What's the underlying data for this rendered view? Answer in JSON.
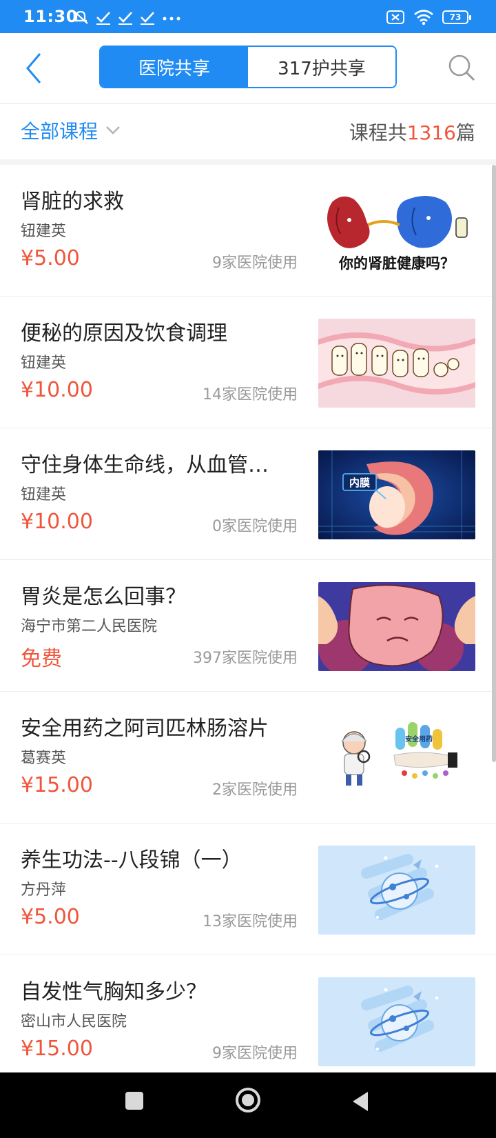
{
  "status_bar": {
    "time": "11:30",
    "battery": "73",
    "icons": [
      "notification-muted-icon",
      "check-icon",
      "check-icon",
      "check-icon",
      "more-icon",
      "sim-icon",
      "wifi-icon",
      "battery-icon"
    ]
  },
  "header": {
    "tabs": [
      {
        "label": "医院共享",
        "active": true
      },
      {
        "label": "317护共享",
        "active": false
      }
    ],
    "icons": {
      "back": "back-chevron-icon",
      "search": "search-icon"
    }
  },
  "filter": {
    "dropdown_label": "全部课程",
    "count_prefix": "课程共",
    "count_value": "1316",
    "count_suffix": "篇"
  },
  "courses": [
    {
      "title": "肾脏的求救",
      "author": "钮建英",
      "price": "¥5.00",
      "usage": "9家医院使用",
      "thumb": "kidney-illustration"
    },
    {
      "title": "便秘的原因及饮食调理",
      "author": "钮建英",
      "price": "¥10.00",
      "usage": "14家医院使用",
      "thumb": "intestine-illustration"
    },
    {
      "title": "守住身体生命线，从血管…",
      "author": "钮建英",
      "price": "¥10.00",
      "usage": "0家医院使用",
      "thumb": "blood-vessel-illustration",
      "thumb_text": "内膜"
    },
    {
      "title": "胃炎是怎么回事？",
      "author": "海宁市第二人民医院",
      "price": "免费",
      "usage": "397家医院使用",
      "thumb": "stomach-illustration"
    },
    {
      "title": "安全用药之阿司匹林肠溶片",
      "author": "葛赛英",
      "price": "¥15.00",
      "usage": "2家医院使用",
      "thumb": "medicine-illustration",
      "thumb_text": "安全用药"
    },
    {
      "title": "养生功法--八段锦（一）",
      "author": "方丹萍",
      "price": "¥5.00",
      "usage": "13家医院使用",
      "thumb": "placeholder-planet"
    },
    {
      "title": "自发性气胸知多少？",
      "author": "密山市人民医院",
      "price": "¥15.00",
      "usage": "9家医院使用",
      "thumb": "placeholder-planet"
    }
  ],
  "kidney_caption": "你的肾脏健康吗？",
  "colors": {
    "accent": "#1f8bf3",
    "price": "#f0553b",
    "text": "#222222",
    "muted": "#9a9a9a"
  }
}
